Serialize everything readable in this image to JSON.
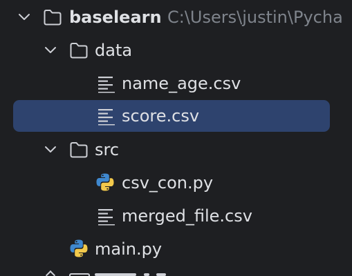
{
  "project_tree": {
    "root": {
      "name": "baselearn",
      "path": "C:\\Users\\justin\\Pycha",
      "icon": "folder-icon",
      "expanded": true
    },
    "data_folder": {
      "name": "data",
      "icon": "folder-icon",
      "expanded": true,
      "files": [
        {
          "name": "name_age.csv",
          "icon": "text-file-icon"
        },
        {
          "name": "score.csv",
          "icon": "text-file-icon",
          "selected": true
        }
      ]
    },
    "src_folder": {
      "name": "src",
      "icon": "folder-icon",
      "expanded": true,
      "files": [
        {
          "name": "csv_con.py",
          "icon": "python-file-icon"
        },
        {
          "name": "merged_file.csv",
          "icon": "text-file-icon"
        }
      ]
    },
    "root_files": [
      {
        "name": "main.py",
        "icon": "python-file-icon"
      }
    ]
  },
  "colors": {
    "background": "#1e1f22",
    "selection": "#2e436e",
    "text": "#dfe1e5",
    "path_text": "#7f848c",
    "icon_gray": "#ced0d6",
    "python_blue": "#3f88cf",
    "python_yellow": "#f2c94c"
  }
}
